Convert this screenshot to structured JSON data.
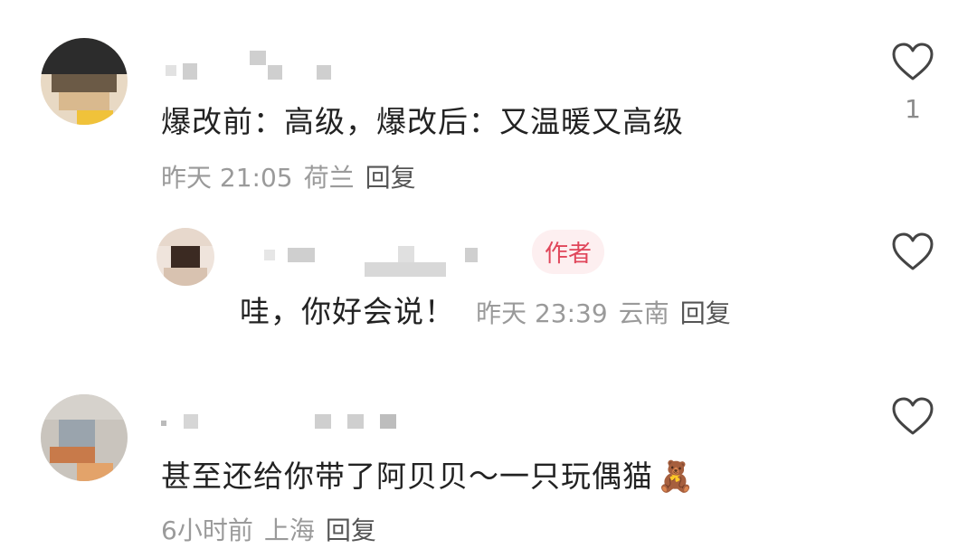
{
  "comments": [
    {
      "text": "爆改前：高级，爆改后：又温暖又高级",
      "time": "昨天 21:05",
      "location": "荷兰",
      "reply_label": "回复",
      "like_count": "1",
      "icon": "heart-outline-icon"
    },
    {
      "badge": "作者",
      "text": "哇，你好会说！",
      "time": "昨天 23:39",
      "location": "云南",
      "reply_label": "回复",
      "icon": "heart-outline-icon"
    },
    {
      "text": "甚至还给你带了阿贝贝～一只玩偶猫",
      "emoji": "🧸",
      "emoji_name": "teddy-bear-icon",
      "time": "6小时前",
      "location": "上海",
      "reply_label": "回复",
      "icon": "heart-outline-icon"
    }
  ],
  "colors": {
    "badge_bg": "#fdeff0",
    "badge_text": "#e0465a",
    "meta_text": "#9a9a9a",
    "content_text": "#222222"
  }
}
